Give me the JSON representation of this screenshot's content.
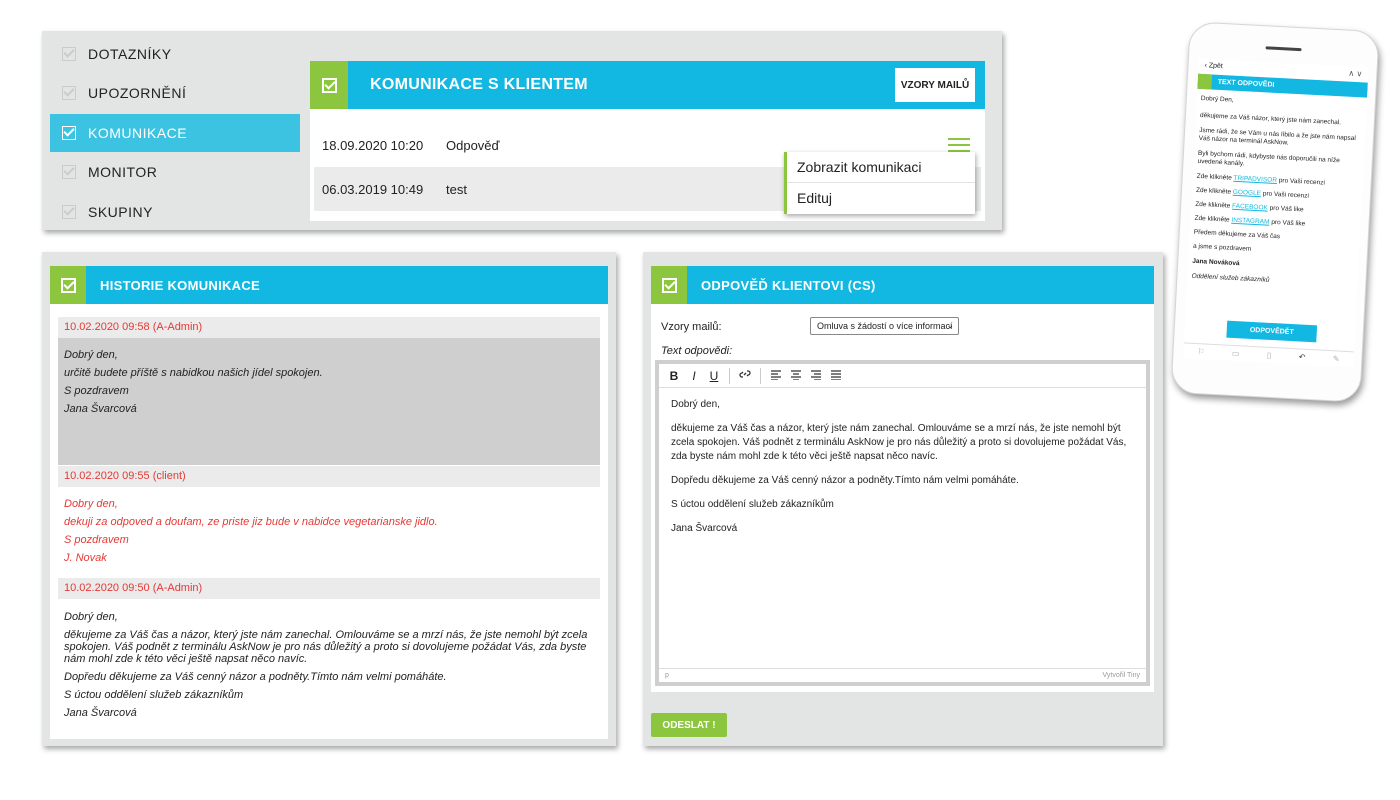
{
  "top": {
    "sidebar": [
      {
        "label": "DOTAZNÍKY",
        "active": false
      },
      {
        "label": "UPOZORNĚNÍ",
        "active": false
      },
      {
        "label": "KOMUNIKACE",
        "active": true
      },
      {
        "label": "MONITOR",
        "active": false
      },
      {
        "label": "SKUPINY",
        "active": false
      }
    ],
    "title": "KOMUNIKACE S KLIENTEM",
    "templates_button": "VZORY MAILŮ",
    "rows": [
      {
        "date": "18.09.2020 10:20",
        "subject": "Odpověď"
      },
      {
        "date": "06.03.2019 10:49",
        "subject": "test"
      }
    ],
    "menu": [
      "Zobrazit komunikaci",
      "Edituj"
    ]
  },
  "history": {
    "title": "HISTORIE KOMUNIKACE",
    "entries": [
      {
        "date": "10.02.2020 09:58 (A-Admin)",
        "lines": [
          "Dobrý den,",
          "určitě budete příště s nabidkou našich jídel spokojen.",
          "S pozdravem",
          "Jana Švarcová"
        ]
      },
      {
        "date": "10.02.2020 09:55 (client)",
        "lines": [
          "Dobry den,",
          "dekuji za odpoved a doufam, ze priste jiz bude v nabidce vegetarianske jidlo.",
          "S pozdravem",
          "J. Novak"
        ]
      },
      {
        "date": "10.02.2020 09:50 (A-Admin)",
        "lines": [
          "Dobrý den,",
          "děkujeme za Váš čas a názor, který jste nám zanechal. Omlouváme se a mrzí nás, že jste nemohl být zcela spokojen. Váš podnět z terminálu AskNow je pro nás důležitý a proto si dovolujeme požádat Vás, zda byste nám mohl zde k této věci ještě napsat něco navíc.",
          "Dopředu děkujeme za Váš cenný názor a podněty.Tímto nám velmi pomáháte.",
          "S úctou oddělení služeb zákazníkům",
          "Jana Švarcová"
        ]
      }
    ]
  },
  "reply": {
    "title": "ODPOVĚĎ KLIENTOVI (CS)",
    "templates_label": "Vzory mailů:",
    "templates_selected": "Omluva s žádostí o více informací",
    "text_label": "Text odpovědi:",
    "toolbar": {
      "bold": "B",
      "italic": "I",
      "underline": "U"
    },
    "editor": [
      "Dobrý den,",
      "děkujeme za Váš čas a názor, který jste nám zanechal. Omlouváme se a mrzí nás, že jste nemohl být zcela spokojen. Váš podnět z terminálu AskNow je pro nás důležitý a proto si dovolujeme požádat Vás, zda byste nám mohl zde k této věci ještě napsat něco navíc.",
      "Dopředu děkujeme za Váš cenný názor a podněty.Tímto nám velmi pomáháte.",
      "S úctou oddělení služeb zákazníkům",
      "Jana Švarcová"
    ],
    "status_left": "p",
    "status_right": "Vytvořil Tiny",
    "send_button": "ODESLAT !"
  },
  "mobile": {
    "back": "Zpět",
    "title": "TEXT ODPOVĚDI",
    "greeting": "Dobrý Den,",
    "p1": "děkujeme za Váš názor, který jste nám zanechal.",
    "p2": "Jsme rádi, že se Vám u nás líbilo a že jste nám napsal Váš názor na terminál AskNow.",
    "p3": "Byli bychom rádi, kdybyste nás doporučili na níže uvedené kanály.",
    "links": [
      {
        "pre": "Zde klikněte ",
        "link": "TRIPADVISOR",
        "post": " pro Vaši recenzi"
      },
      {
        "pre": "Zde klikněte ",
        "link": "GOOGLE",
        "post": " pro Vaši recenzi"
      },
      {
        "pre": "Zde klikněte ",
        "link": "FACEBOOK",
        "post": " pro Váš like"
      },
      {
        "pre": "Zde klikněte ",
        "link": "INSTAGRAM",
        "post": " pro Váš like"
      }
    ],
    "thanks": "Předem děkujeme za Váš čas",
    "regards": "a jsme s pozdravem",
    "name": "Jana Nováková",
    "dept": "Oddělení služeb zákazníků",
    "button": "ODPOVĚDĚT"
  },
  "colors": {
    "accent_blue": "#12b8e2",
    "accent_green": "#8cc63f",
    "red_text": "#e53935"
  }
}
